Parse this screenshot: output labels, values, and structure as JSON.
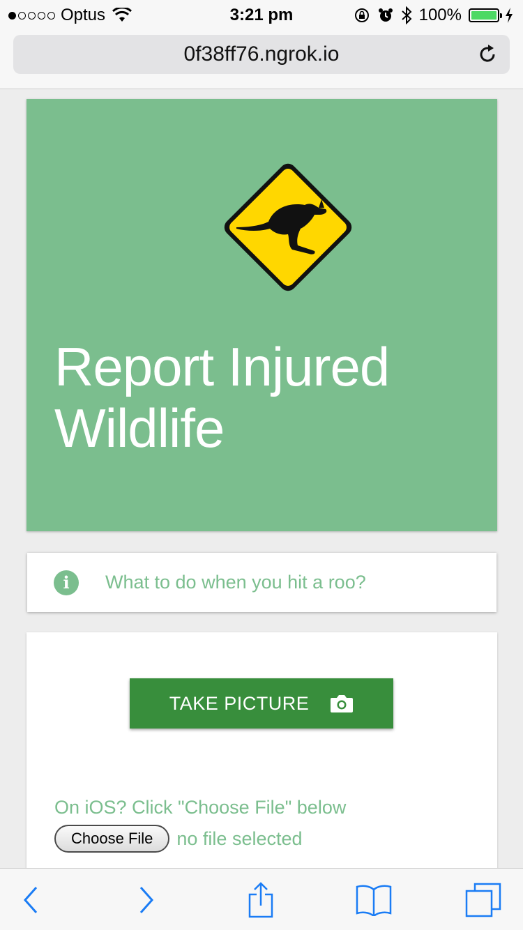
{
  "status": {
    "carrier": "Optus",
    "time": "3:21 pm",
    "battery": "100%",
    "signal_bars_filled": 1,
    "signal_bars_total": 5
  },
  "browser": {
    "url": "0f38ff76.ngrok.io"
  },
  "hero": {
    "title": "Report Injured Wildlife"
  },
  "info": {
    "text": "What to do when you hit a roo?"
  },
  "form": {
    "take_picture_label": "TAKE PICTURE",
    "ios_hint": "On iOS? Click \"Choose File\" below",
    "choose_file_label": "Choose File",
    "no_file_text": "no file selected"
  },
  "colors": {
    "accent_green": "#7bbe8e",
    "button_green": "#388e3c",
    "ios_blue": "#1a7cf5",
    "sign_yellow": "#ffd700"
  },
  "icons": [
    "wifi-icon",
    "lock-rotation-icon",
    "alarm-icon",
    "bluetooth-icon",
    "battery-icon",
    "charging-icon",
    "reload-icon",
    "kangaroo-sign-icon",
    "info-icon",
    "camera-icon",
    "back-icon",
    "forward-icon",
    "share-icon",
    "bookmarks-icon",
    "tabs-icon"
  ]
}
